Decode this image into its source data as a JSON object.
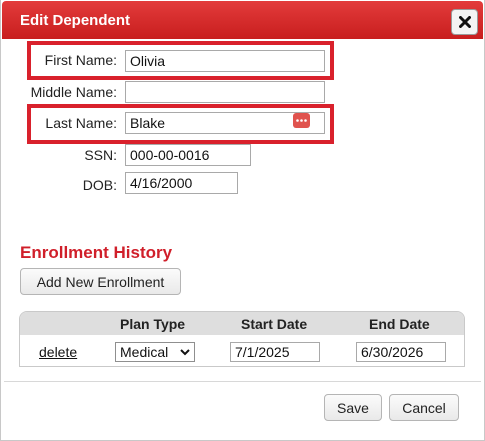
{
  "dialog": {
    "title": "Edit Dependent",
    "close_icon": "close-x-icon"
  },
  "form": {
    "first_name": {
      "label": "First Name:",
      "value": "Olivia"
    },
    "middle_name": {
      "label": "Middle Name:",
      "value": ""
    },
    "last_name": {
      "label": "Last Name:",
      "value": "Blake"
    },
    "ssn": {
      "label": "SSN:",
      "value": "000-00-0016"
    },
    "dob": {
      "label": "DOB:",
      "value": "4/16/2000"
    }
  },
  "enrollment": {
    "section_title": "Enrollment History",
    "add_button": "Add New Enrollment",
    "columns": [
      "Plan Type",
      "Start Date",
      "End Date"
    ],
    "rows": [
      {
        "action": "delete",
        "plan_type": "Medical",
        "start_date": "7/1/2025",
        "end_date": "6/30/2026"
      }
    ]
  },
  "footer": {
    "save_label": "Save",
    "cancel_label": "Cancel"
  },
  "colors": {
    "titlebar": "#d52a2a",
    "highlight_box": "#d9212c",
    "section_title": "#d01f2a"
  }
}
